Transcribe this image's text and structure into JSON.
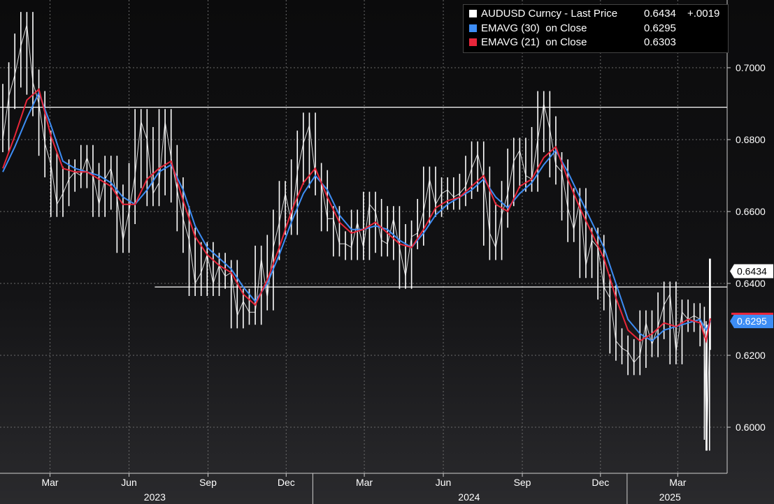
{
  "chart_data": {
    "type": "line",
    "xlim": [
      "2023-01-05",
      "2025-04-08"
    ],
    "ylim": [
      0.588,
      0.716
    ],
    "ytick_values": [
      0.6,
      0.62,
      0.64,
      0.66,
      0.68,
      0.7
    ],
    "ytick_labels": [
      "0.6000",
      "0.6200",
      "0.6400",
      "0.6600",
      "0.6800",
      "0.7000"
    ],
    "month_ticks": [
      {
        "label": "Mar",
        "date": "2023-03-01"
      },
      {
        "label": "Jun",
        "date": "2023-06-01"
      },
      {
        "label": "Sep",
        "date": "2023-09-01"
      },
      {
        "label": "Dec",
        "date": "2023-12-01"
      },
      {
        "label": "Mar",
        "date": "2024-03-01"
      },
      {
        "label": "Jun",
        "date": "2024-06-01"
      },
      {
        "label": "Sep",
        "date": "2024-09-01"
      },
      {
        "label": "Dec",
        "date": "2024-12-01"
      },
      {
        "label": "Mar",
        "date": "2025-03-01"
      }
    ],
    "year_labels": [
      {
        "label": "2023",
        "date": "2023-07-01"
      },
      {
        "label": "2024",
        "date": "2024-07-01"
      },
      {
        "label": "2025",
        "date": "2025-02-20"
      }
    ],
    "year_separators": [
      "2024-01-01",
      "2025-01-01"
    ],
    "grid": true,
    "legend_position": "top-right",
    "reference_lines": [
      {
        "y": 0.689,
        "from": "2023-01-05",
        "to": "2025-04-08"
      },
      {
        "y": 0.639,
        "from": "2023-07-01",
        "to": "2025-04-08"
      }
    ],
    "last_value_labels": [
      {
        "text": "0.6434",
        "value": 0.6434,
        "color": "#ffffff",
        "text_color": "#000000"
      },
      {
        "text": "0.6295",
        "value": 0.6295,
        "color": "#3d8df5",
        "text_color": "#ffffff"
      }
    ],
    "red_marker_value": 0.6303,
    "series": [
      {
        "name": "AUDUSD Curncy - Last Price",
        "color": "#ffffff",
        "style": "bars",
        "points": [
          [
            "2023-01-05",
            0.68
          ],
          [
            "2023-01-12",
            0.692
          ],
          [
            "2023-01-19",
            0.698
          ],
          [
            "2023-01-26",
            0.706
          ],
          [
            "2023-02-02",
            0.712
          ],
          [
            "2023-02-09",
            0.696
          ],
          [
            "2023-02-16",
            0.69
          ],
          [
            "2023-02-23",
            0.679
          ],
          [
            "2023-03-02",
            0.673
          ],
          [
            "2023-03-09",
            0.662
          ],
          [
            "2023-03-16",
            0.665
          ],
          [
            "2023-03-23",
            0.669
          ],
          [
            "2023-03-30",
            0.671
          ],
          [
            "2023-04-06",
            0.67
          ],
          [
            "2023-04-13",
            0.675
          ],
          [
            "2023-04-20",
            0.67
          ],
          [
            "2023-04-27",
            0.662
          ],
          [
            "2023-05-04",
            0.669
          ],
          [
            "2023-05-11",
            0.672
          ],
          [
            "2023-05-18",
            0.664
          ],
          [
            "2023-05-25",
            0.652
          ],
          [
            "2023-06-01",
            0.66
          ],
          [
            "2023-06-08",
            0.67
          ],
          [
            "2023-06-15",
            0.685
          ],
          [
            "2023-06-22",
            0.68
          ],
          [
            "2023-06-29",
            0.665
          ],
          [
            "2023-07-06",
            0.668
          ],
          [
            "2023-07-13",
            0.685
          ],
          [
            "2023-07-20",
            0.675
          ],
          [
            "2023-07-27",
            0.666
          ],
          [
            "2023-08-03",
            0.658
          ],
          [
            "2023-08-10",
            0.652
          ],
          [
            "2023-08-17",
            0.64
          ],
          [
            "2023-08-24",
            0.643
          ],
          [
            "2023-08-31",
            0.648
          ],
          [
            "2023-09-07",
            0.64
          ],
          [
            "2023-09-14",
            0.645
          ],
          [
            "2023-09-21",
            0.642
          ],
          [
            "2023-09-28",
            0.643
          ],
          [
            "2023-10-05",
            0.631
          ],
          [
            "2023-10-12",
            0.635
          ],
          [
            "2023-10-19",
            0.632
          ],
          [
            "2023-10-26",
            0.632
          ],
          [
            "2023-11-02",
            0.647
          ],
          [
            "2023-11-09",
            0.636
          ],
          [
            "2023-11-16",
            0.65
          ],
          [
            "2023-11-23",
            0.657
          ],
          [
            "2023-11-30",
            0.665
          ],
          [
            "2023-12-07",
            0.657
          ],
          [
            "2023-12-14",
            0.671
          ],
          [
            "2023-12-21",
            0.679
          ],
          [
            "2023-12-28",
            0.684
          ],
          [
            "2024-01-04",
            0.67
          ],
          [
            "2024-01-11",
            0.668
          ],
          [
            "2024-01-18",
            0.658
          ],
          [
            "2024-01-25",
            0.658
          ],
          [
            "2024-02-01",
            0.651
          ],
          [
            "2024-02-08",
            0.651
          ],
          [
            "2024-02-15",
            0.65
          ],
          [
            "2024-02-22",
            0.657
          ],
          [
            "2024-02-29",
            0.65
          ],
          [
            "2024-03-07",
            0.662
          ],
          [
            "2024-03-14",
            0.66
          ],
          [
            "2024-03-21",
            0.652
          ],
          [
            "2024-03-28",
            0.651
          ],
          [
            "2024-04-04",
            0.658
          ],
          [
            "2024-04-11",
            0.65
          ],
          [
            "2024-04-18",
            0.642
          ],
          [
            "2024-04-25",
            0.653
          ],
          [
            "2024-05-02",
            0.654
          ],
          [
            "2024-05-09",
            0.66
          ],
          [
            "2024-05-16",
            0.669
          ],
          [
            "2024-05-23",
            0.662
          ],
          [
            "2024-05-30",
            0.665
          ],
          [
            "2024-06-06",
            0.666
          ],
          [
            "2024-06-13",
            0.664
          ],
          [
            "2024-06-20",
            0.665
          ],
          [
            "2024-06-27",
            0.667
          ],
          [
            "2024-07-04",
            0.672
          ],
          [
            "2024-07-11",
            0.676
          ],
          [
            "2024-07-18",
            0.669
          ],
          [
            "2024-07-25",
            0.654
          ],
          [
            "2024-08-01",
            0.65
          ],
          [
            "2024-08-08",
            0.659
          ],
          [
            "2024-08-15",
            0.665
          ],
          [
            "2024-08-22",
            0.674
          ],
          [
            "2024-08-29",
            0.677
          ],
          [
            "2024-09-05",
            0.67
          ],
          [
            "2024-09-12",
            0.669
          ],
          [
            "2024-09-19",
            0.68
          ],
          [
            "2024-09-26",
            0.69
          ],
          [
            "2024-10-03",
            0.683
          ],
          [
            "2024-10-10",
            0.673
          ],
          [
            "2024-10-17",
            0.671
          ],
          [
            "2024-10-24",
            0.661
          ],
          [
            "2024-10-31",
            0.655
          ],
          [
            "2024-11-07",
            0.663
          ],
          [
            "2024-11-14",
            0.645
          ],
          [
            "2024-11-21",
            0.652
          ],
          [
            "2024-11-28",
            0.65
          ],
          [
            "2024-12-05",
            0.639
          ],
          [
            "2024-12-12",
            0.636
          ],
          [
            "2024-12-19",
            0.624
          ],
          [
            "2024-12-26",
            0.622
          ],
          [
            "2025-01-02",
            0.621
          ],
          [
            "2025-01-09",
            0.618
          ],
          [
            "2025-01-16",
            0.62
          ],
          [
            "2025-01-23",
            0.629
          ],
          [
            "2025-01-30",
            0.623
          ],
          [
            "2025-02-06",
            0.628
          ],
          [
            "2025-02-13",
            0.634
          ],
          [
            "2025-02-20",
            0.637
          ],
          [
            "2025-02-27",
            0.621
          ],
          [
            "2025-03-06",
            0.632
          ],
          [
            "2025-03-13",
            0.63
          ],
          [
            "2025-03-20",
            0.631
          ],
          [
            "2025-03-27",
            0.63
          ],
          [
            "2025-04-01",
            0.626
          ],
          [
            "2025-04-03",
            0.6
          ],
          [
            "2025-04-04",
            0.597
          ],
          [
            "2025-04-07",
            0.625
          ],
          [
            "2025-04-08",
            0.6434
          ]
        ]
      },
      {
        "name": "EMAVG (30) on Close",
        "color": "#3d8df5",
        "style": "line",
        "points": [
          [
            "2023-01-05",
            0.671
          ],
          [
            "2023-01-19",
            0.678
          ],
          [
            "2023-02-02",
            0.686
          ],
          [
            "2023-02-16",
            0.693
          ],
          [
            "2023-03-02",
            0.684
          ],
          [
            "2023-03-16",
            0.674
          ],
          [
            "2023-03-30",
            0.672
          ],
          [
            "2023-04-13",
            0.671
          ],
          [
            "2023-04-27",
            0.67
          ],
          [
            "2023-05-11",
            0.668
          ],
          [
            "2023-05-25",
            0.664
          ],
          [
            "2023-06-08",
            0.662
          ],
          [
            "2023-06-22",
            0.666
          ],
          [
            "2023-07-06",
            0.671
          ],
          [
            "2023-07-20",
            0.673
          ],
          [
            "2023-08-03",
            0.666
          ],
          [
            "2023-08-17",
            0.656
          ],
          [
            "2023-08-31",
            0.65
          ],
          [
            "2023-09-14",
            0.647
          ],
          [
            "2023-09-28",
            0.644
          ],
          [
            "2023-10-12",
            0.639
          ],
          [
            "2023-10-26",
            0.635
          ],
          [
            "2023-11-09",
            0.64
          ],
          [
            "2023-11-23",
            0.648
          ],
          [
            "2023-12-07",
            0.657
          ],
          [
            "2023-12-21",
            0.665
          ],
          [
            "2024-01-04",
            0.67
          ],
          [
            "2024-01-18",
            0.666
          ],
          [
            "2024-02-01",
            0.659
          ],
          [
            "2024-02-15",
            0.655
          ],
          [
            "2024-02-29",
            0.655
          ],
          [
            "2024-03-14",
            0.656
          ],
          [
            "2024-03-28",
            0.655
          ],
          [
            "2024-04-11",
            0.652
          ],
          [
            "2024-04-25",
            0.65
          ],
          [
            "2024-05-09",
            0.654
          ],
          [
            "2024-05-23",
            0.659
          ],
          [
            "2024-06-06",
            0.662
          ],
          [
            "2024-06-20",
            0.664
          ],
          [
            "2024-07-04",
            0.666
          ],
          [
            "2024-07-18",
            0.669
          ],
          [
            "2024-08-01",
            0.664
          ],
          [
            "2024-08-15",
            0.661
          ],
          [
            "2024-08-29",
            0.665
          ],
          [
            "2024-09-12",
            0.668
          ],
          [
            "2024-09-26",
            0.673
          ],
          [
            "2024-10-10",
            0.677
          ],
          [
            "2024-10-24",
            0.671
          ],
          [
            "2024-11-07",
            0.664
          ],
          [
            "2024-11-21",
            0.657
          ],
          [
            "2024-12-05",
            0.65
          ],
          [
            "2024-12-19",
            0.64
          ],
          [
            "2025-01-02",
            0.63
          ],
          [
            "2025-01-16",
            0.626
          ],
          [
            "2025-01-30",
            0.624
          ],
          [
            "2025-02-13",
            0.627
          ],
          [
            "2025-02-27",
            0.628
          ],
          [
            "2025-03-13",
            0.629
          ],
          [
            "2025-03-27",
            0.63
          ],
          [
            "2025-04-03",
            0.627
          ],
          [
            "2025-04-08",
            0.6295
          ]
        ]
      },
      {
        "name": "EMAVG (21) on Close",
        "color": "#e8263a",
        "style": "line",
        "points": [
          [
            "2023-01-05",
            0.672
          ],
          [
            "2023-01-19",
            0.681
          ],
          [
            "2023-02-02",
            0.691
          ],
          [
            "2023-02-16",
            0.694
          ],
          [
            "2023-03-02",
            0.681
          ],
          [
            "2023-03-16",
            0.672
          ],
          [
            "2023-03-30",
            0.671
          ],
          [
            "2023-04-13",
            0.671
          ],
          [
            "2023-04-27",
            0.669
          ],
          [
            "2023-05-11",
            0.667
          ],
          [
            "2023-05-25",
            0.662
          ],
          [
            "2023-06-08",
            0.662
          ],
          [
            "2023-06-22",
            0.669
          ],
          [
            "2023-07-06",
            0.672
          ],
          [
            "2023-07-20",
            0.674
          ],
          [
            "2023-08-03",
            0.663
          ],
          [
            "2023-08-17",
            0.653
          ],
          [
            "2023-08-31",
            0.648
          ],
          [
            "2023-09-14",
            0.645
          ],
          [
            "2023-09-28",
            0.643
          ],
          [
            "2023-10-12",
            0.637
          ],
          [
            "2023-10-26",
            0.634
          ],
          [
            "2023-11-09",
            0.641
          ],
          [
            "2023-11-23",
            0.65
          ],
          [
            "2023-12-07",
            0.66
          ],
          [
            "2023-12-21",
            0.668
          ],
          [
            "2024-01-04",
            0.672
          ],
          [
            "2024-01-18",
            0.664
          ],
          [
            "2024-02-01",
            0.657
          ],
          [
            "2024-02-15",
            0.654
          ],
          [
            "2024-02-29",
            0.655
          ],
          [
            "2024-03-14",
            0.657
          ],
          [
            "2024-03-28",
            0.654
          ],
          [
            "2024-04-11",
            0.651
          ],
          [
            "2024-04-25",
            0.65
          ],
          [
            "2024-05-09",
            0.655
          ],
          [
            "2024-05-23",
            0.661
          ],
          [
            "2024-06-06",
            0.663
          ],
          [
            "2024-06-20",
            0.664
          ],
          [
            "2024-07-04",
            0.667
          ],
          [
            "2024-07-18",
            0.67
          ],
          [
            "2024-08-01",
            0.662
          ],
          [
            "2024-08-15",
            0.66
          ],
          [
            "2024-08-29",
            0.667
          ],
          [
            "2024-09-12",
            0.669
          ],
          [
            "2024-09-26",
            0.675
          ],
          [
            "2024-10-10",
            0.678
          ],
          [
            "2024-10-24",
            0.669
          ],
          [
            "2024-11-07",
            0.661
          ],
          [
            "2024-11-21",
            0.654
          ],
          [
            "2024-12-05",
            0.647
          ],
          [
            "2024-12-19",
            0.636
          ],
          [
            "2025-01-02",
            0.627
          ],
          [
            "2025-01-16",
            0.624
          ],
          [
            "2025-01-30",
            0.626
          ],
          [
            "2025-02-13",
            0.629
          ],
          [
            "2025-02-27",
            0.628
          ],
          [
            "2025-03-13",
            0.63
          ],
          [
            "2025-03-27",
            0.629
          ],
          [
            "2025-04-03",
            0.624
          ],
          [
            "2025-04-08",
            0.6303
          ]
        ]
      }
    ]
  },
  "legend": {
    "rows": [
      {
        "swatch_color": "#ffffff",
        "name": "AUDUSD Curncy - Last Price",
        "value": "0.6434",
        "change": "+.0019"
      },
      {
        "swatch_color": "#3d8df5",
        "name": "EMAVG (30)  on Close",
        "value": "0.6295"
      },
      {
        "swatch_color": "#e8263a",
        "name": "EMAVG (21)  on Close",
        "value": "0.6303"
      }
    ]
  }
}
